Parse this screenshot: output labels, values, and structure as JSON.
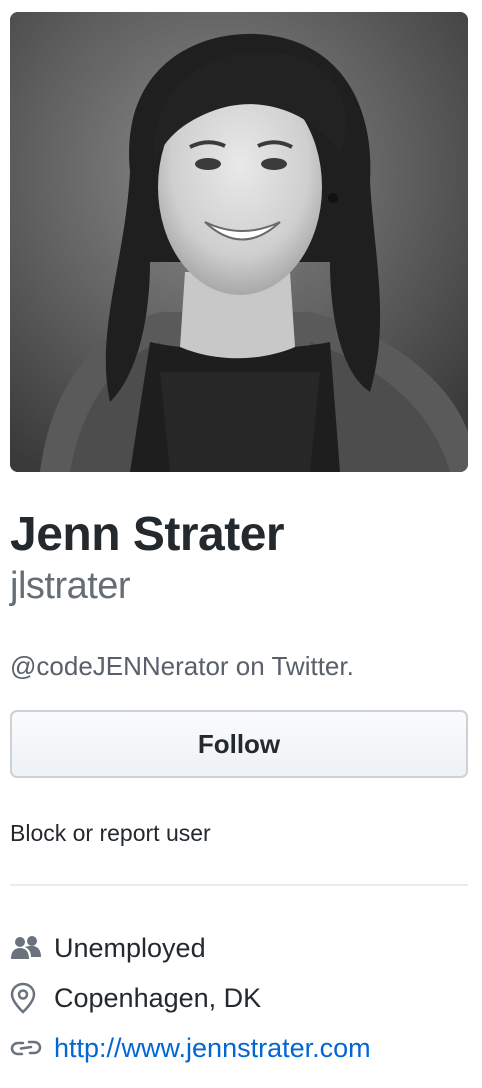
{
  "profile": {
    "avatar_alt": "Jenn Strater",
    "full_name": "Jenn Strater",
    "username": "jlstrater",
    "bio": "@codeJENNerator on Twitter.",
    "follow_label": "Follow",
    "block_report_label": "Block or report user"
  },
  "details": {
    "organization": "Unemployed",
    "organization_icon": "people-icon",
    "location": "Copenhagen, DK",
    "location_icon": "location-pin-icon",
    "website": "http://www.jennstrater.com",
    "website_icon": "link-icon",
    "link_color": "#0366d6"
  }
}
